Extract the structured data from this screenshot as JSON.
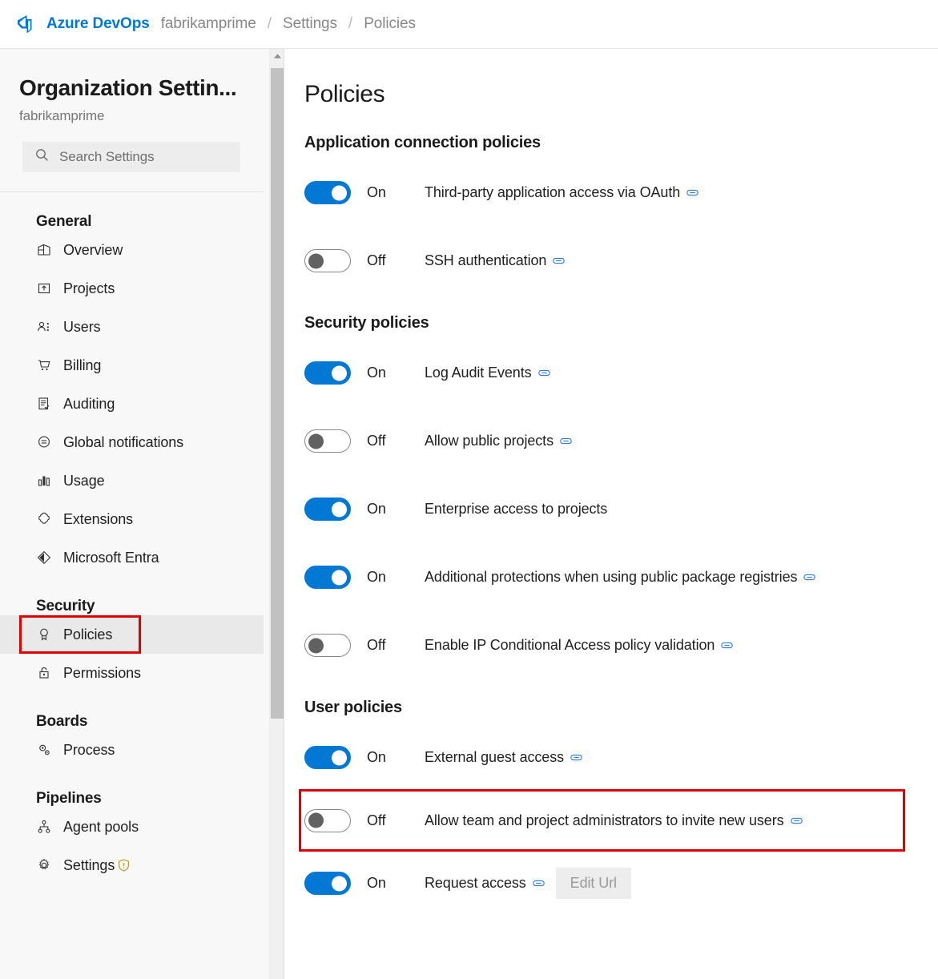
{
  "header": {
    "logo_icon": "azure-devops-logo",
    "brand": "Azure DevOps",
    "breadcrumb": [
      "fabrikamprime",
      "Settings",
      "Policies"
    ],
    "separator": "/"
  },
  "sidebar": {
    "title": "Organization Settin...",
    "subtitle": "fabrikamprime",
    "search": {
      "placeholder": "Search Settings",
      "icon": "search-icon"
    },
    "groups": [
      {
        "title": "General",
        "items": [
          {
            "label": "Overview",
            "icon": "overview-icon"
          },
          {
            "label": "Projects",
            "icon": "projects-icon"
          },
          {
            "label": "Users",
            "icon": "users-icon"
          },
          {
            "label": "Billing",
            "icon": "billing-cart-icon"
          },
          {
            "label": "Auditing",
            "icon": "auditing-icon"
          },
          {
            "label": "Global notifications",
            "icon": "notifications-icon"
          },
          {
            "label": "Usage",
            "icon": "usage-chart-icon"
          },
          {
            "label": "Extensions",
            "icon": "extensions-puzzle-icon"
          },
          {
            "label": "Microsoft Entra",
            "icon": "microsoft-entra-icon"
          }
        ]
      },
      {
        "title": "Security",
        "items": [
          {
            "label": "Policies",
            "icon": "policies-ribbon-icon",
            "selected": true,
            "highlighted": true
          },
          {
            "label": "Permissions",
            "icon": "permissions-lock-icon"
          }
        ]
      },
      {
        "title": "Boards",
        "items": [
          {
            "label": "Process",
            "icon": "process-gears-icon"
          }
        ]
      },
      {
        "title": "Pipelines",
        "items": [
          {
            "label": "Agent pools",
            "icon": "agent-pools-icon"
          },
          {
            "label": "Settings",
            "icon": "gear-icon",
            "badge_icon": "shield-warning-icon"
          }
        ]
      }
    ]
  },
  "main": {
    "page_title": "Policies",
    "sections": [
      {
        "title": "Application connection policies",
        "policies": [
          {
            "state": "On",
            "on": true,
            "label": "Third-party application access via OAuth",
            "link_icon": "link-icon"
          },
          {
            "state": "Off",
            "on": false,
            "label": "SSH authentication",
            "link_icon": "link-icon"
          }
        ]
      },
      {
        "title": "Security policies",
        "policies": [
          {
            "state": "On",
            "on": true,
            "label": "Log Audit Events",
            "link_icon": "link-icon"
          },
          {
            "state": "Off",
            "on": false,
            "label": "Allow public projects",
            "link_icon": "link-icon"
          },
          {
            "state": "On",
            "on": true,
            "label": "Enterprise access to projects",
            "link_icon": null
          },
          {
            "state": "On",
            "on": true,
            "label": "Additional protections when using public package registries",
            "link_icon": "link-icon"
          },
          {
            "state": "Off",
            "on": false,
            "label": "Enable IP Conditional Access policy validation",
            "link_icon": "link-icon"
          }
        ]
      },
      {
        "title": "User policies",
        "policies": [
          {
            "state": "On",
            "on": true,
            "label": "External guest access",
            "link_icon": "link-icon"
          },
          {
            "state": "Off",
            "on": false,
            "label": "Allow team and project administrators to invite new users",
            "link_icon": "link-icon",
            "highlighted": true
          },
          {
            "state": "On",
            "on": true,
            "label": "Request access",
            "link_icon": "link-icon",
            "button": "Edit Url"
          }
        ]
      }
    ]
  },
  "colors": {
    "brand_blue": "#0078d4",
    "toggle_on": "#0078d4",
    "toggle_off_knob": "#616161",
    "highlight_red": "#e00000",
    "sidebar_bg": "#f8f8f8",
    "selected_bg": "#e9e9e9",
    "link_icon_blue": "#2b7cd3",
    "shield_warning": "#c09a2e"
  }
}
